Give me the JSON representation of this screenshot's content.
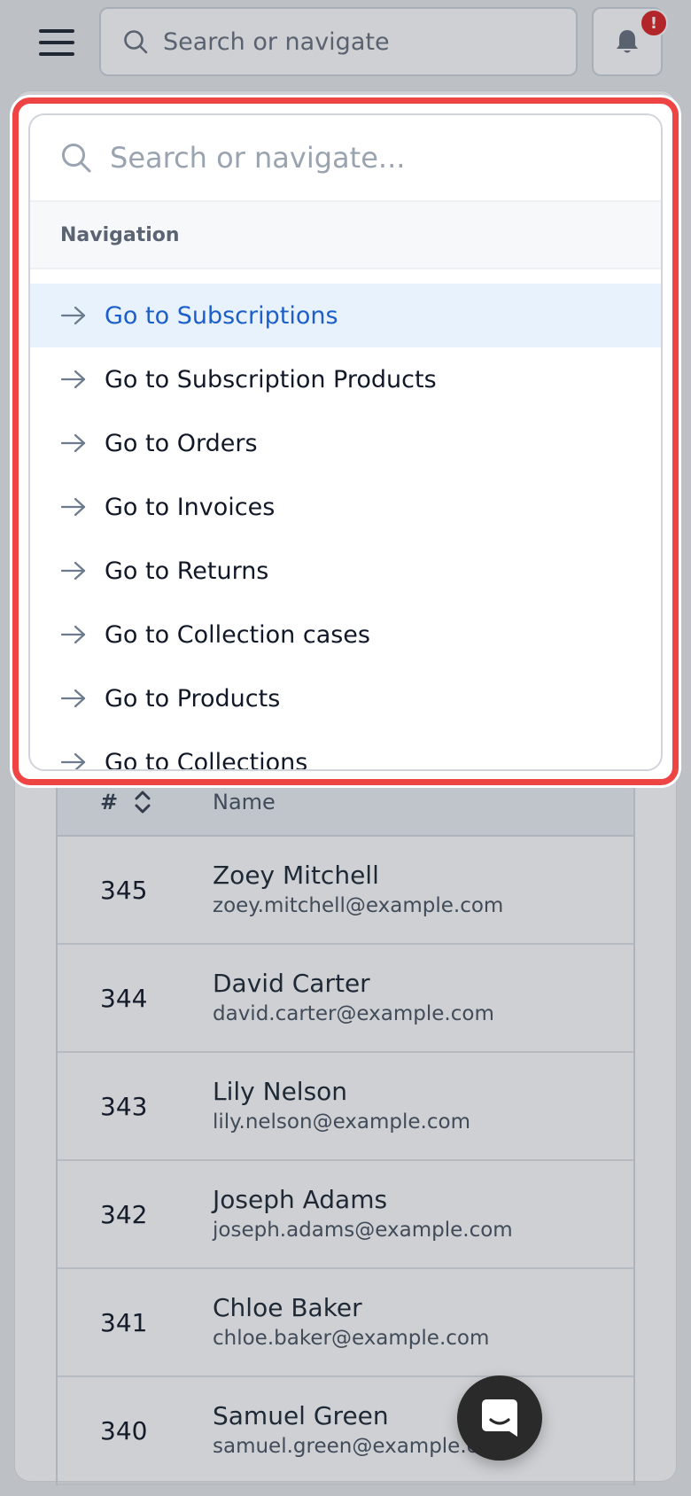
{
  "header": {
    "search_placeholder": "Search or navigate",
    "notification_badge": "!"
  },
  "table": {
    "columns": [
      "#",
      "Name"
    ],
    "rows": [
      {
        "id": "345",
        "name": "Zoey Mitchell",
        "email": "zoey.mitchell@example.com"
      },
      {
        "id": "344",
        "name": "David Carter",
        "email": "david.carter@example.com"
      },
      {
        "id": "343",
        "name": "Lily Nelson",
        "email": "lily.nelson@example.com"
      },
      {
        "id": "342",
        "name": "Joseph Adams",
        "email": "joseph.adams@example.com"
      },
      {
        "id": "341",
        "name": "Chloe Baker",
        "email": "chloe.baker@example.com"
      },
      {
        "id": "340",
        "name": "Samuel Green",
        "email": "samuel.green@example.com"
      }
    ]
  },
  "palette": {
    "search_placeholder": "Search or navigate...",
    "section_label": "Navigation",
    "items": [
      {
        "label": "Go to Subscriptions"
      },
      {
        "label": "Go to Subscription Products"
      },
      {
        "label": "Go to Orders"
      },
      {
        "label": "Go to Invoices"
      },
      {
        "label": "Go to Returns"
      },
      {
        "label": "Go to Collection cases"
      },
      {
        "label": "Go to Products"
      },
      {
        "label": "Go to Collections"
      }
    ]
  },
  "colors": {
    "highlight": "#ef4444",
    "active_text": "#1d5fc8",
    "active_bg": "#e8f2fd",
    "badge": "#dc2626"
  }
}
